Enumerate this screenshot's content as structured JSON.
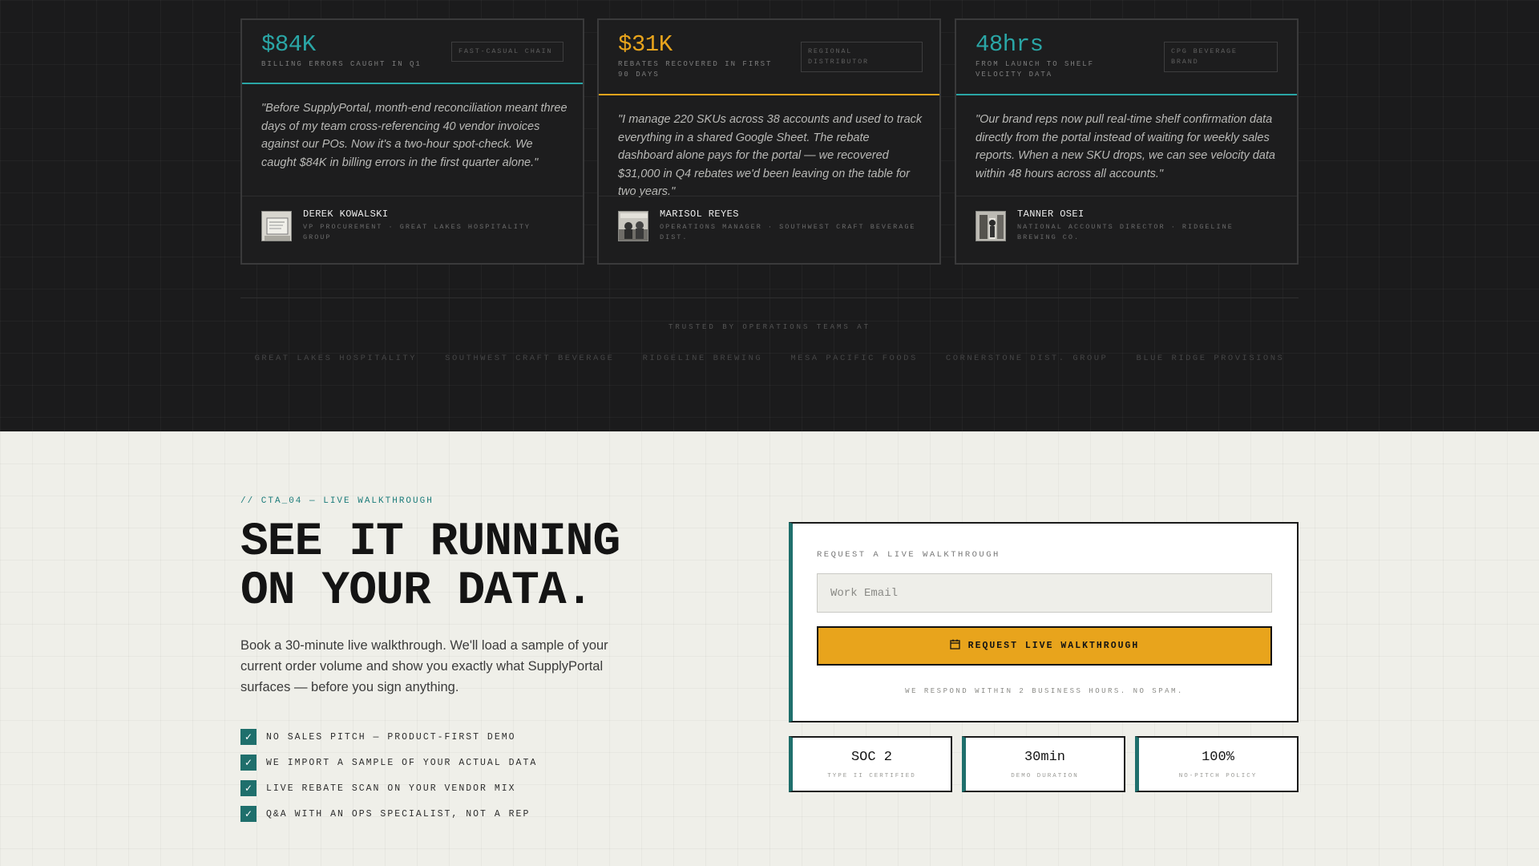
{
  "testimonials": [
    {
      "metric": "$84K",
      "metric_label": "BILLING ERRORS CAUGHT IN Q1",
      "tag": "FAST-CASUAL CHAIN",
      "quote": "\"Before SupplyPortal, month-end reconciliation meant three days of my team cross-referencing 40 vendor invoices against our POs. Now it's a two-hour spot-check. We caught $84K in billing errors in the first quarter alone.\"",
      "author_name": "DEREK KOWALSKI",
      "author_role": "VP PROCUREMENT · GREAT LAKES HOSPITALITY GROUP",
      "accent": "#2aa6a6"
    },
    {
      "metric": "$31K",
      "metric_label": "REBATES RECOVERED IN FIRST 90 DAYS",
      "tag": "REGIONAL DISTRIBUTOR",
      "quote": "\"I manage 220 SKUs across 38 accounts and used to track everything in a shared Google Sheet. The rebate dashboard alone pays for the portal — we recovered $31,000 in Q4 rebates we'd been leaving on the table for two years.\"",
      "author_name": "MARISOL REYES",
      "author_role": "OPERATIONS MANAGER · SOUTHWEST CRAFT BEVERAGE DIST.",
      "accent": "#e8a41c"
    },
    {
      "metric": "48hrs",
      "metric_label": "FROM LAUNCH TO SHELF VELOCITY DATA",
      "tag": "CPG BEVERAGE BRAND",
      "quote": "\"Our brand reps now pull real-time shelf confirmation data directly from the portal instead of waiting for weekly sales reports. When a new SKU drops, we can see velocity data within 48 hours across all accounts.\"",
      "author_name": "TANNER OSEI",
      "author_role": "NATIONAL ACCOUNTS DIRECTOR · RIDGELINE BREWING CO.",
      "accent": "#2aa6a6"
    }
  ],
  "trusted": {
    "label": "TRUSTED BY OPERATIONS TEAMS AT",
    "logos": [
      "GREAT LAKES HOSPITALITY",
      "SOUTHWEST CRAFT BEVERAGE",
      "RIDGELINE BREWING",
      "MESA PACIFIC FOODS",
      "CORNERSTONE DIST. GROUP",
      "BLUE RIDGE PROVISIONS"
    ]
  },
  "cta": {
    "eyebrow": "// CTA_04 — LIVE WALKTHROUGH",
    "headline_line1": "SEE IT RUNNING",
    "headline_line2": "ON YOUR DATA.",
    "lead": "Book a 30-minute live walkthrough. We'll load a sample of your current order volume and show you exactly what SupplyPortal surfaces — before you sign anything.",
    "checklist": [
      "NO SALES PITCH — PRODUCT-FIRST DEMO",
      "WE IMPORT A SAMPLE OF YOUR ACTUAL DATA",
      "LIVE REBATE SCAN ON YOUR VENDOR MIX",
      "Q&A WITH AN OPS SPECIALIST, NOT A REP"
    ]
  },
  "form": {
    "label": "REQUEST A LIVE WALKTHROUGH",
    "email_placeholder": "Work Email",
    "email_value": "",
    "button_label": "REQUEST LIVE WALKTHROUGH",
    "button_icon": "calendar-icon",
    "note": "WE RESPOND WITHIN 2 BUSINESS HOURS. NO SPAM."
  },
  "stats": [
    {
      "value": "SOC 2",
      "label": "TYPE II CERTIFIED"
    },
    {
      "value": "30min",
      "label": "DEMO DURATION"
    },
    {
      "value": "100%",
      "label": "NO-PITCH POLICY"
    }
  ],
  "colors": {
    "teal": "#1f6f6c",
    "teal_light": "#2aa6a6",
    "amber": "#e8a41c",
    "dark_bg": "#1b1b1c",
    "light_bg": "#efefe9"
  }
}
